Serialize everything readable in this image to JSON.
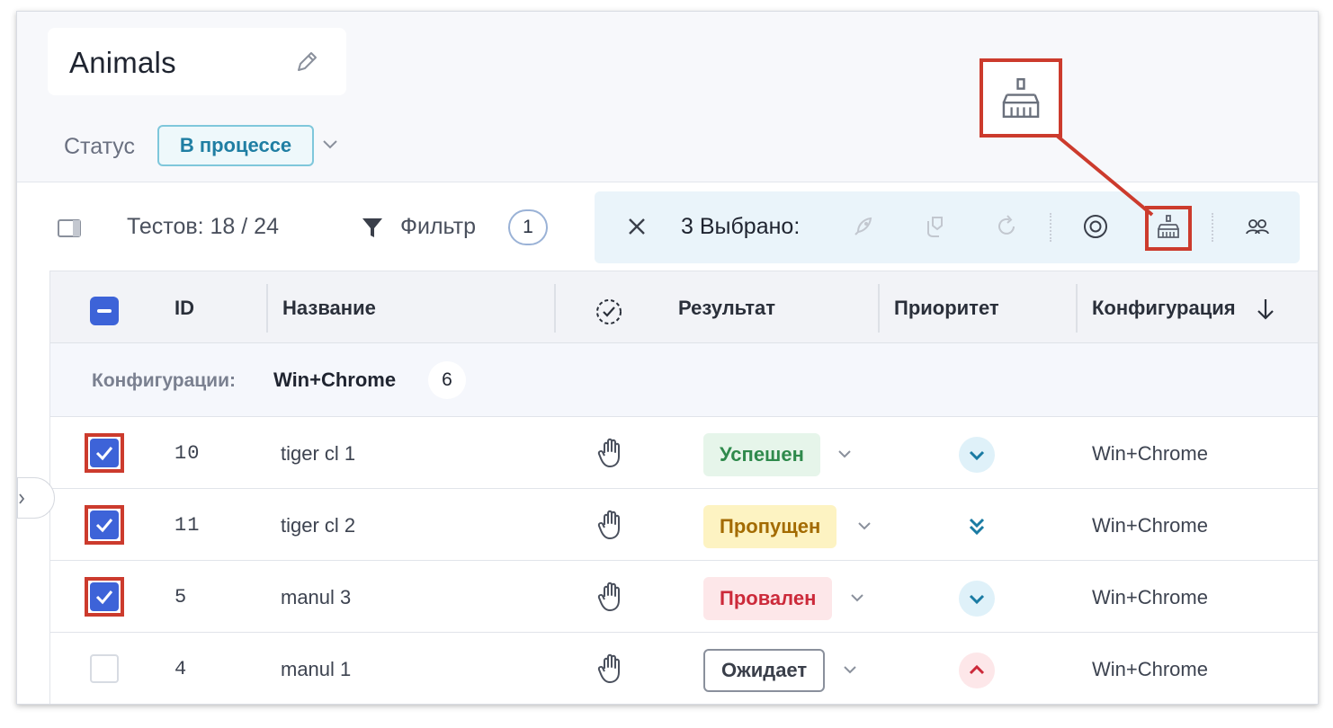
{
  "header": {
    "title": "Animals",
    "status_label": "Статус",
    "status_value": "В процессе"
  },
  "toolbar": {
    "tests_count": "Тестов: 18 / 24",
    "filter_label": "Фильтр",
    "filter_count": "1"
  },
  "selection": {
    "count_label": "3 Выбрано:",
    "actions": [
      "rocket-icon",
      "reassign-icon",
      "refresh-icon",
      "target-icon",
      "broom-icon",
      "users-icon"
    ]
  },
  "table": {
    "headers": {
      "id": "ID",
      "name": "Название",
      "result": "Результат",
      "priority": "Приоритет",
      "config": "Конфигурация"
    },
    "group": {
      "label": "Конфигурации:",
      "value": "Win+Chrome",
      "count": "6"
    },
    "rows": [
      {
        "id": "10",
        "name": "tiger cl 1",
        "result": "Успешен",
        "priority": "low",
        "config": "Win+Chrome",
        "checked": true
      },
      {
        "id": "11",
        "name": "tiger cl 2",
        "result": "Пропущен",
        "priority": "lowest",
        "config": "Win+Chrome",
        "checked": true
      },
      {
        "id": "5",
        "name": "manul 3",
        "result": "Провален",
        "priority": "low",
        "config": "Win+Chrome",
        "checked": true
      },
      {
        "id": "4",
        "name": "manul 1",
        "result": "Ожидает",
        "priority": "high",
        "config": "Win+Chrome",
        "checked": false
      }
    ]
  },
  "colors": {
    "accent": "#3d63d8",
    "highlight": "#cc3b2d",
    "passed_bg": "#e6f5ea",
    "passed_fg": "#2f8a4c",
    "skipped_bg": "#fdf3c2",
    "skipped_fg": "#a36b00",
    "failed_bg": "#fde7e9",
    "failed_fg": "#cc2a3a"
  }
}
